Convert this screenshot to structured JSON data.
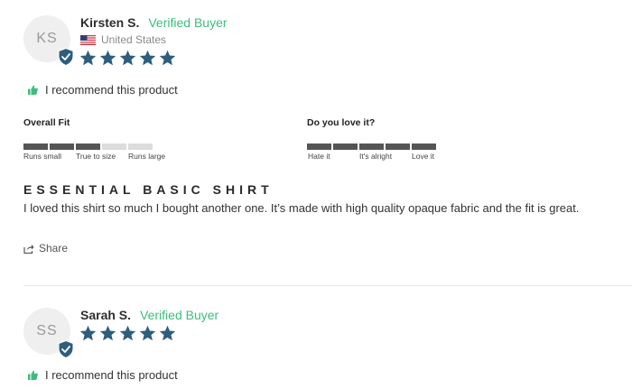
{
  "colors": {
    "star": "#2e5e7e",
    "verified": "#3dbd7d",
    "badge": "#2e5e7e",
    "bar_on": "#555555",
    "bar_off": "#dcdcdc"
  },
  "reviews": [
    {
      "initials": "KS",
      "name": "Kirsten S.",
      "verified_label": "Verified Buyer",
      "country": "United States",
      "rating": 5,
      "recommend_text": "I recommend this product",
      "overall_fit": {
        "label": "Overall Fit",
        "value": 3,
        "max": 5,
        "scale_labels": [
          "Runs small",
          "True to size",
          "Runs large"
        ]
      },
      "love_it": {
        "label": "Do you love it?",
        "value": 5,
        "max": 5,
        "scale_labels": [
          "Hate it",
          "It's alright",
          "Love it"
        ]
      },
      "title": "ESSENTIAL BASIC SHIRT",
      "body": "I loved this shirt so much I bought another one. It’s made with high quality opaque fabric and the fit is great.",
      "share_label": "Share"
    },
    {
      "initials": "SS",
      "name": "Sarah S.",
      "verified_label": "Verified Buyer",
      "rating": 5,
      "recommend_text": "I recommend this product"
    }
  ],
  "icons": {
    "verified_badge": "shield-check-icon",
    "star": "star-icon",
    "thumb": "thumbs-up-icon",
    "share": "share-icon",
    "flag": "us-flag-icon"
  }
}
